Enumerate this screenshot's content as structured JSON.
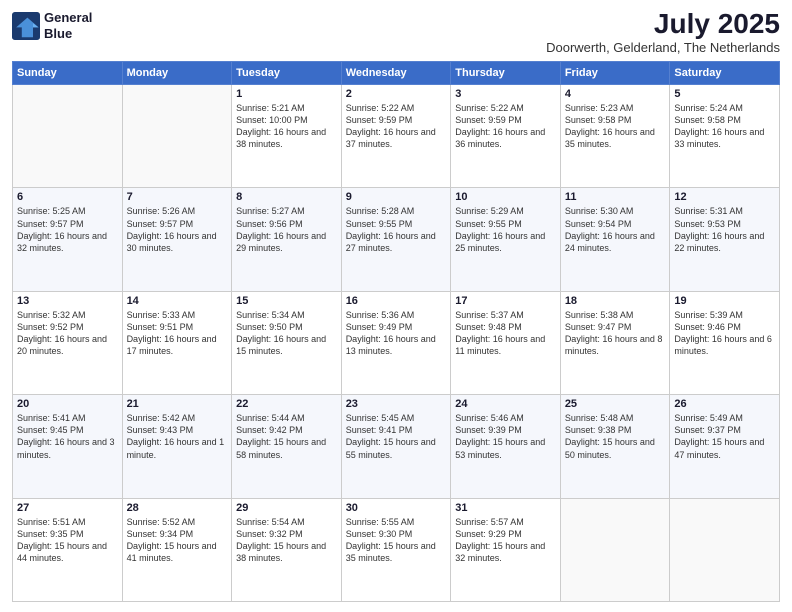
{
  "logo": {
    "line1": "General",
    "line2": "Blue"
  },
  "title": "July 2025",
  "location": "Doorwerth, Gelderland, The Netherlands",
  "days_of_week": [
    "Sunday",
    "Monday",
    "Tuesday",
    "Wednesday",
    "Thursday",
    "Friday",
    "Saturday"
  ],
  "weeks": [
    {
      "cells": [
        {
          "day": "",
          "empty": true
        },
        {
          "day": "",
          "empty": true
        },
        {
          "day": "1",
          "sunrise": "5:21 AM",
          "sunset": "10:00 PM",
          "daylight": "16 hours and 38 minutes."
        },
        {
          "day": "2",
          "sunrise": "5:22 AM",
          "sunset": "9:59 PM",
          "daylight": "16 hours and 37 minutes."
        },
        {
          "day": "3",
          "sunrise": "5:22 AM",
          "sunset": "9:59 PM",
          "daylight": "16 hours and 36 minutes."
        },
        {
          "day": "4",
          "sunrise": "5:23 AM",
          "sunset": "9:58 PM",
          "daylight": "16 hours and 35 minutes."
        },
        {
          "day": "5",
          "sunrise": "5:24 AM",
          "sunset": "9:58 PM",
          "daylight": "16 hours and 33 minutes."
        }
      ]
    },
    {
      "cells": [
        {
          "day": "6",
          "sunrise": "5:25 AM",
          "sunset": "9:57 PM",
          "daylight": "16 hours and 32 minutes."
        },
        {
          "day": "7",
          "sunrise": "5:26 AM",
          "sunset": "9:57 PM",
          "daylight": "16 hours and 30 minutes."
        },
        {
          "day": "8",
          "sunrise": "5:27 AM",
          "sunset": "9:56 PM",
          "daylight": "16 hours and 29 minutes."
        },
        {
          "day": "9",
          "sunrise": "5:28 AM",
          "sunset": "9:55 PM",
          "daylight": "16 hours and 27 minutes."
        },
        {
          "day": "10",
          "sunrise": "5:29 AM",
          "sunset": "9:55 PM",
          "daylight": "16 hours and 25 minutes."
        },
        {
          "day": "11",
          "sunrise": "5:30 AM",
          "sunset": "9:54 PM",
          "daylight": "16 hours and 24 minutes."
        },
        {
          "day": "12",
          "sunrise": "5:31 AM",
          "sunset": "9:53 PM",
          "daylight": "16 hours and 22 minutes."
        }
      ]
    },
    {
      "cells": [
        {
          "day": "13",
          "sunrise": "5:32 AM",
          "sunset": "9:52 PM",
          "daylight": "16 hours and 20 minutes."
        },
        {
          "day": "14",
          "sunrise": "5:33 AM",
          "sunset": "9:51 PM",
          "daylight": "16 hours and 17 minutes."
        },
        {
          "day": "15",
          "sunrise": "5:34 AM",
          "sunset": "9:50 PM",
          "daylight": "16 hours and 15 minutes."
        },
        {
          "day": "16",
          "sunrise": "5:36 AM",
          "sunset": "9:49 PM",
          "daylight": "16 hours and 13 minutes."
        },
        {
          "day": "17",
          "sunrise": "5:37 AM",
          "sunset": "9:48 PM",
          "daylight": "16 hours and 11 minutes."
        },
        {
          "day": "18",
          "sunrise": "5:38 AM",
          "sunset": "9:47 PM",
          "daylight": "16 hours and 8 minutes."
        },
        {
          "day": "19",
          "sunrise": "5:39 AM",
          "sunset": "9:46 PM",
          "daylight": "16 hours and 6 minutes."
        }
      ]
    },
    {
      "cells": [
        {
          "day": "20",
          "sunrise": "5:41 AM",
          "sunset": "9:45 PM",
          "daylight": "16 hours and 3 minutes."
        },
        {
          "day": "21",
          "sunrise": "5:42 AM",
          "sunset": "9:43 PM",
          "daylight": "16 hours and 1 minute."
        },
        {
          "day": "22",
          "sunrise": "5:44 AM",
          "sunset": "9:42 PM",
          "daylight": "15 hours and 58 minutes."
        },
        {
          "day": "23",
          "sunrise": "5:45 AM",
          "sunset": "9:41 PM",
          "daylight": "15 hours and 55 minutes."
        },
        {
          "day": "24",
          "sunrise": "5:46 AM",
          "sunset": "9:39 PM",
          "daylight": "15 hours and 53 minutes."
        },
        {
          "day": "25",
          "sunrise": "5:48 AM",
          "sunset": "9:38 PM",
          "daylight": "15 hours and 50 minutes."
        },
        {
          "day": "26",
          "sunrise": "5:49 AM",
          "sunset": "9:37 PM",
          "daylight": "15 hours and 47 minutes."
        }
      ]
    },
    {
      "cells": [
        {
          "day": "27",
          "sunrise": "5:51 AM",
          "sunset": "9:35 PM",
          "daylight": "15 hours and 44 minutes."
        },
        {
          "day": "28",
          "sunrise": "5:52 AM",
          "sunset": "9:34 PM",
          "daylight": "15 hours and 41 minutes."
        },
        {
          "day": "29",
          "sunrise": "5:54 AM",
          "sunset": "9:32 PM",
          "daylight": "15 hours and 38 minutes."
        },
        {
          "day": "30",
          "sunrise": "5:55 AM",
          "sunset": "9:30 PM",
          "daylight": "15 hours and 35 minutes."
        },
        {
          "day": "31",
          "sunrise": "5:57 AM",
          "sunset": "9:29 PM",
          "daylight": "15 hours and 32 minutes."
        },
        {
          "day": "",
          "empty": true
        },
        {
          "day": "",
          "empty": true
        }
      ]
    }
  ]
}
